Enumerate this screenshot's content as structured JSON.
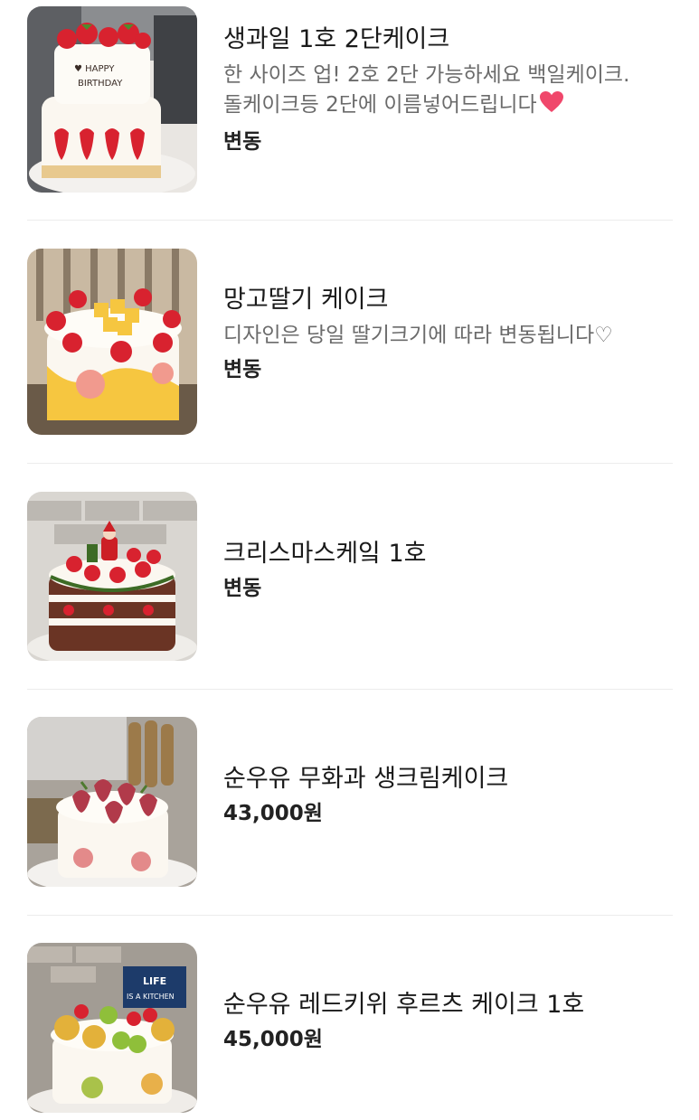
{
  "menu": {
    "items": [
      {
        "title": "생과일 1호 2단케이크",
        "desc_line1": "한 사이즈 업! 2호 2단 가능하세요 백일케이크.",
        "desc_line2": "돌케이크등 2단에 이름넣어드립니다",
        "desc_icon": "heart-icon",
        "price": "변동",
        "cake_text_line1": "♥ HAPPY",
        "cake_text_line2": "BIRTHDAY"
      },
      {
        "title": "망고딸기 케이크",
        "desc_line1": "디자인은 당일 딸기크기에 따라 변동됩니다♡",
        "price": "변동"
      },
      {
        "title": "크리스마스케잌 1호",
        "price": "변동"
      },
      {
        "title": "순우유 무화과 생크림케이크",
        "price": "43,000원"
      },
      {
        "title": "순우유 레드키위 후르츠 케이크 1호",
        "price": "45,000원",
        "sign_text_line1": "LIFE",
        "sign_text_line2": "IS A KITCHEN"
      }
    ]
  },
  "colors": {
    "strawberry": "#d8222f",
    "cream": "#fbf7f0",
    "mango": "#f6c640",
    "heart": "#f0476b",
    "divider": "#ececec"
  }
}
